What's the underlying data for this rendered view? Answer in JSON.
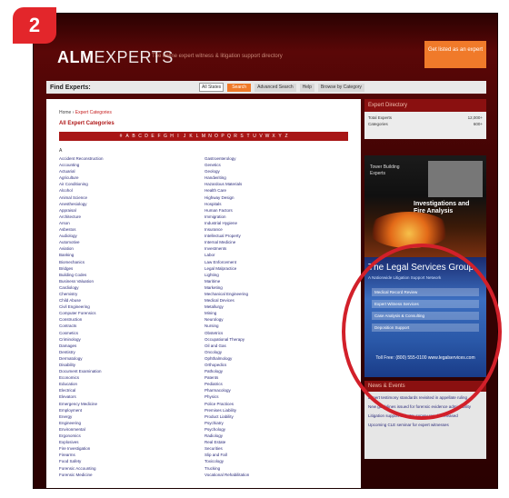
{
  "step_badge": "2",
  "header": {
    "logo_alm": "ALM",
    "logo_experts": "EXPERTS",
    "tagline": "The online expert witness & litigation support directory",
    "cta": "Get listed as an expert"
  },
  "search": {
    "label": "Find Experts:",
    "select_value": "All States",
    "go": "Search",
    "advanced": "Advanced Search",
    "help": "Help",
    "browse": "Browse by Category"
  },
  "main": {
    "crumb_home": "Home",
    "crumb_current": "Expert Categories",
    "title": "All Expert Categories",
    "letters": [
      "#",
      "A",
      "B",
      "C",
      "D",
      "E",
      "F",
      "G",
      "H",
      "I",
      "J",
      "K",
      "L",
      "M",
      "N",
      "O",
      "P",
      "Q",
      "R",
      "S",
      "T",
      "U",
      "V",
      "W",
      "X",
      "Y",
      "Z"
    ],
    "letter_head": "A",
    "left_col": [
      "Accident Reconstruction",
      "Accounting",
      "Actuarial",
      "Agriculture",
      "Air Conditioning",
      "Alcohol",
      "Animal Science",
      "Anesthesiology",
      "Appraisal",
      "Architecture",
      "Arson",
      "Asbestos",
      "Audiology",
      "Automotive",
      "Aviation",
      "Banking",
      "Biomechanics",
      "Bridges",
      "Building Codes",
      "Business Valuation",
      "Cardiology",
      "Chemistry",
      "Child Abuse",
      "Civil Engineering",
      "Computer Forensics",
      "Construction",
      "Contracts",
      "Cosmetics",
      "Criminology",
      "Damages",
      "Dentistry",
      "Dermatology",
      "Disability",
      "Document Examination",
      "Economics",
      "Education",
      "Electrical",
      "Elevators",
      "Emergency Medicine",
      "Employment",
      "Energy",
      "Engineering",
      "Environmental",
      "Ergonomics",
      "Explosives",
      "Fire Investigation",
      "Firearms",
      "Food Safety",
      "Forensic Accounting",
      "Forensic Medicine"
    ],
    "right_col": [
      "Gastroenterology",
      "Genetics",
      "Geology",
      "Handwriting",
      "Hazardous Materials",
      "Health Care",
      "Highway Design",
      "Hospitals",
      "Human Factors",
      "Immigration",
      "Industrial Hygiene",
      "Insurance",
      "Intellectual Property",
      "Internal Medicine",
      "Investments",
      "Labor",
      "Law Enforcement",
      "Legal Malpractice",
      "Lighting",
      "Maritime",
      "Marketing",
      "Mechanical Engineering",
      "Medical Devices",
      "Metallurgy",
      "Mining",
      "Neurology",
      "Nursing",
      "Obstetrics",
      "Occupational Therapy",
      "Oil and Gas",
      "Oncology",
      "Ophthalmology",
      "Orthopedics",
      "Pathology",
      "Patents",
      "Pediatrics",
      "Pharmacology",
      "Physics",
      "Police Practices",
      "Premises Liability",
      "Product Liability",
      "Psychiatry",
      "Psychology",
      "Radiology",
      "Real Estate",
      "Securities",
      "Slip and Fall",
      "Toxicology",
      "Trucking",
      "Vocational Rehabilitation"
    ]
  },
  "sidebar": {
    "head": "Expert Directory",
    "stats": [
      [
        "Total Experts",
        "12,000+"
      ],
      [
        "Categories",
        "600+"
      ]
    ],
    "ad1_text": "Tower Building Experts",
    "ad1_title": "Investigations and Fire Analysis",
    "ad2_title": "The Legal Services Group",
    "ad2_sub": "A Nationwide Litigation Support Network",
    "ad2_lines": [
      "Medical Record Review",
      "Expert Witness Services",
      "Case Analysis & Consulting",
      "Deposition Support"
    ],
    "ad2_phone": "Toll Free: (800) 555-0100  www.legalservices.com",
    "news_head": "News & Events",
    "news": [
      "Expert testimony standards revisited in appellate ruling",
      "New guidelines issued for forensic evidence admissibility",
      "Litigation support industry survey results released",
      "Upcoming CLE seminar for expert witnesses"
    ]
  },
  "colors": {
    "brand_red": "#a81616",
    "orange": "#f07a2a",
    "badge_red": "#e3262b"
  }
}
